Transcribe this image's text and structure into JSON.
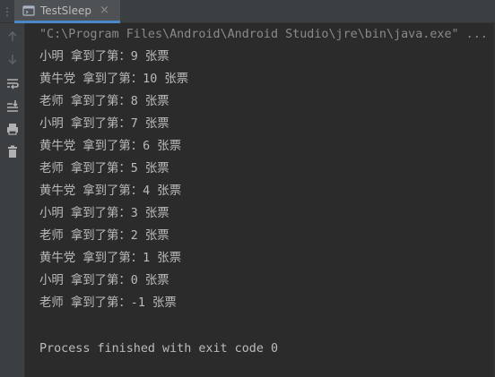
{
  "tabbar": {
    "dots": "⋮",
    "tab": {
      "label": "TestSleep",
      "close": "×"
    }
  },
  "gutter": {
    "icons": [
      "up-arrow-icon",
      "down-arrow-icon",
      "soft-wrap-icon",
      "scroll-to-end-icon",
      "print-icon",
      "trash-icon"
    ]
  },
  "console": {
    "command": "\"C:\\Program Files\\Android\\Android Studio\\jre\\bin\\java.exe\" ...",
    "output_lines": [
      "小明 拿到了第：9 张票",
      "黄牛党 拿到了第：10 张票",
      "老师 拿到了第：8 张票",
      "小明 拿到了第：7 张票",
      "黄牛党 拿到了第：6 张票",
      "老师 拿到了第：5 张票",
      "黄牛党 拿到了第：4 张票",
      "小明 拿到了第：3 张票",
      "老师 拿到了第：2 张票",
      "黄牛党 拿到了第：1 张票",
      "小明 拿到了第：0 张票",
      "老师 拿到了第：-1 张票"
    ],
    "exit_message": "Process finished with exit code 0"
  },
  "colors": {
    "background": "#2b2b2b",
    "panel": "#3c3f41",
    "text": "#bbbbbb",
    "command_text": "#8a8a8a",
    "tab_accent": "#4a88c7"
  }
}
